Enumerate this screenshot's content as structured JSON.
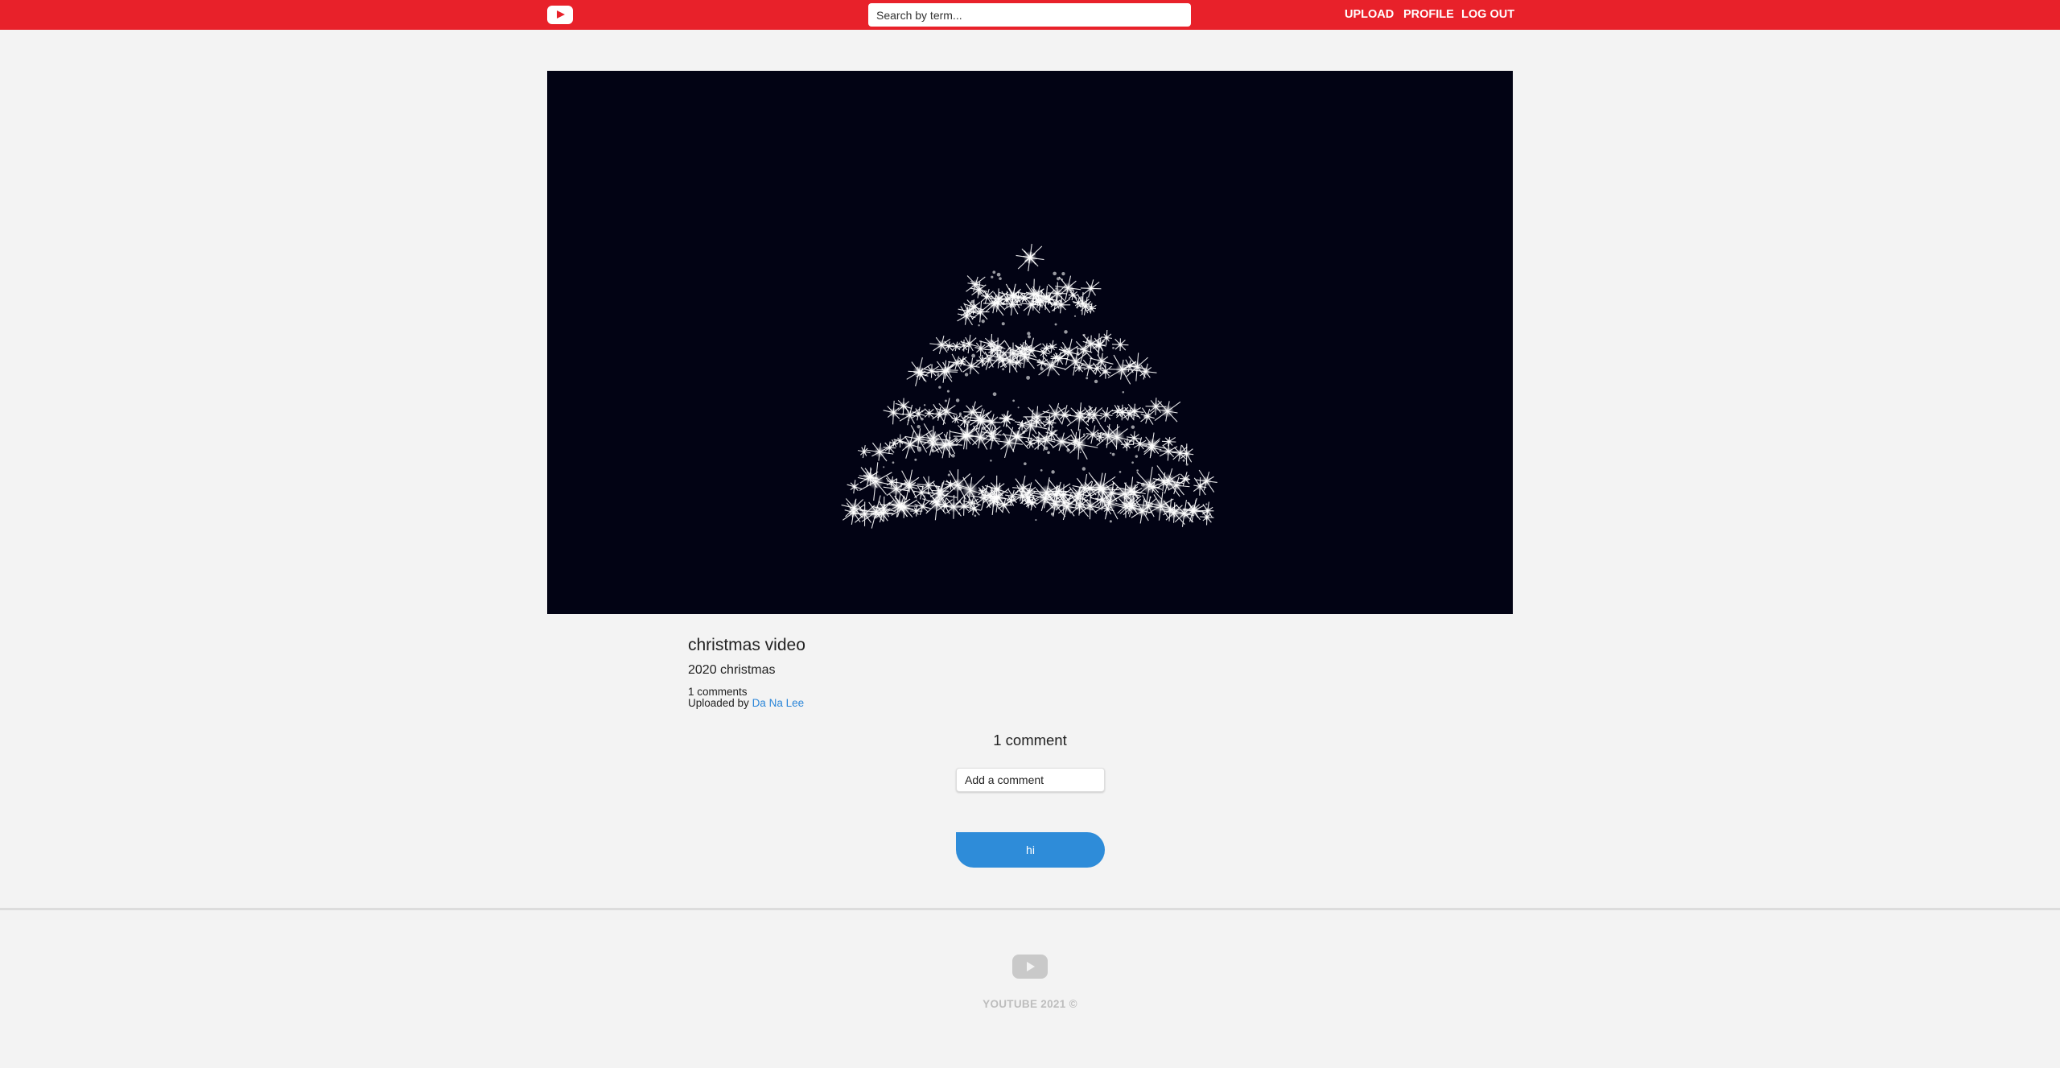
{
  "header": {
    "logo_icon": "play-icon",
    "search_placeholder": "Search by term...",
    "nav": {
      "upload": "Upload",
      "profile": "Profile",
      "logout": "Log Out"
    }
  },
  "video": {
    "title": "christmas video",
    "description": "2020 christmas",
    "comments_count": "1 comments",
    "uploaded_by_prefix": "Uploaded by ",
    "uploader": "Da Na Lee"
  },
  "comments": {
    "heading": "1 comment",
    "input_placeholder": "Add a comment",
    "items": [
      {
        "text": "hi"
      }
    ]
  },
  "footer": {
    "logo_icon": "play-icon",
    "copyright": "YOUTUBE 2021 ©"
  },
  "colors": {
    "brand": "#e8212a",
    "link": "#2b86d8",
    "bubble": "#2e8cd9",
    "video_bg": "#020314"
  }
}
